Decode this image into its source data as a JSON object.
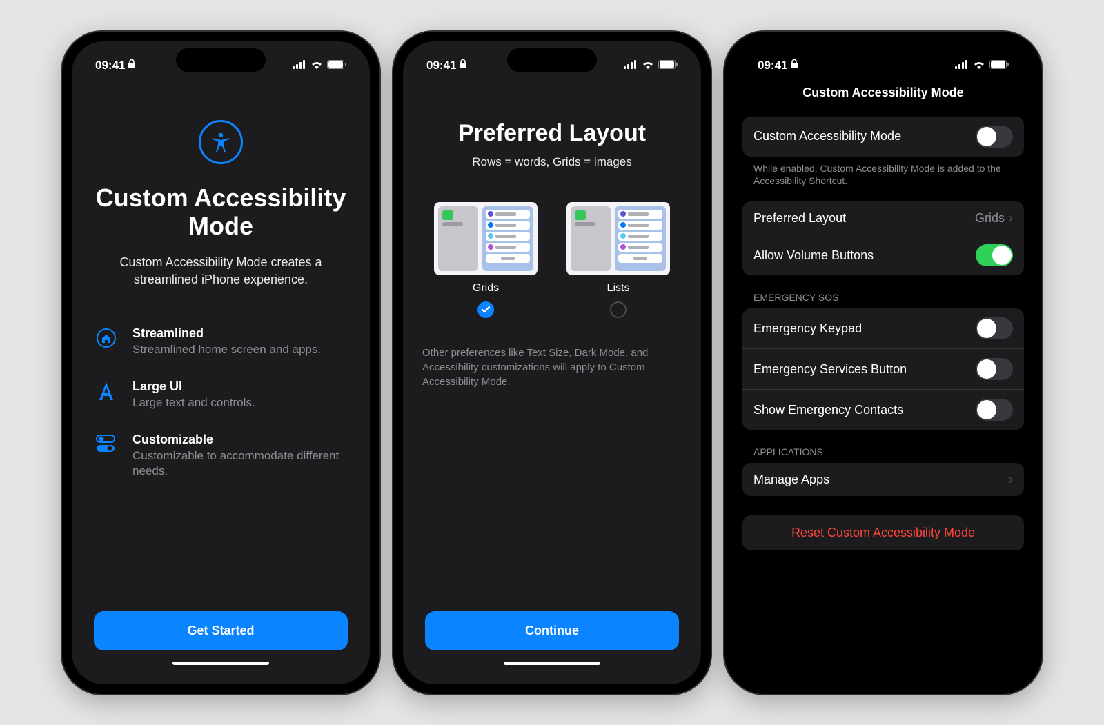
{
  "status": {
    "time": "09:41",
    "lock_icon": "lock-icon"
  },
  "screen1": {
    "title": "Custom Accessibility Mode",
    "description": "Custom Accessibility Mode creates a streamlined iPhone experience.",
    "features": [
      {
        "icon": "home-icon",
        "title": "Streamlined",
        "desc": "Streamlined home screen and apps."
      },
      {
        "icon": "letter-a-icon",
        "title": "Large UI",
        "desc": "Large text and controls."
      },
      {
        "icon": "toggles-icon",
        "title": "Customizable",
        "desc": "Customizable to accommodate different needs."
      }
    ],
    "cta": "Get Started"
  },
  "screen2": {
    "title": "Preferred Layout",
    "subtitle": "Rows = words, Grids = images",
    "options": [
      {
        "label": "Grids",
        "selected": true
      },
      {
        "label": "Lists",
        "selected": false
      }
    ],
    "note": "Other preferences like Text Size, Dark Mode, and Accessibility customizations will apply to Custom Accessibility Mode.",
    "cta": "Continue"
  },
  "screen3": {
    "header": "Custom Accessibility Mode",
    "main_toggle_label": "Custom Accessibility Mode",
    "main_toggle_on": false,
    "main_footer": "While enabled, Custom Accessibility Mode is added to the Accessibility Shortcut.",
    "preferred_layout_label": "Preferred Layout",
    "preferred_layout_value": "Grids",
    "allow_volume_label": "Allow Volume Buttons",
    "allow_volume_on": true,
    "emergency_header": "EMERGENCY SOS",
    "emergency_rows": [
      {
        "label": "Emergency Keypad",
        "on": false
      },
      {
        "label": "Emergency Services Button",
        "on": false
      },
      {
        "label": "Show Emergency Contacts",
        "on": false
      }
    ],
    "applications_header": "APPLICATIONS",
    "manage_apps_label": "Manage Apps",
    "reset_label": "Reset Custom Accessibility Mode"
  }
}
